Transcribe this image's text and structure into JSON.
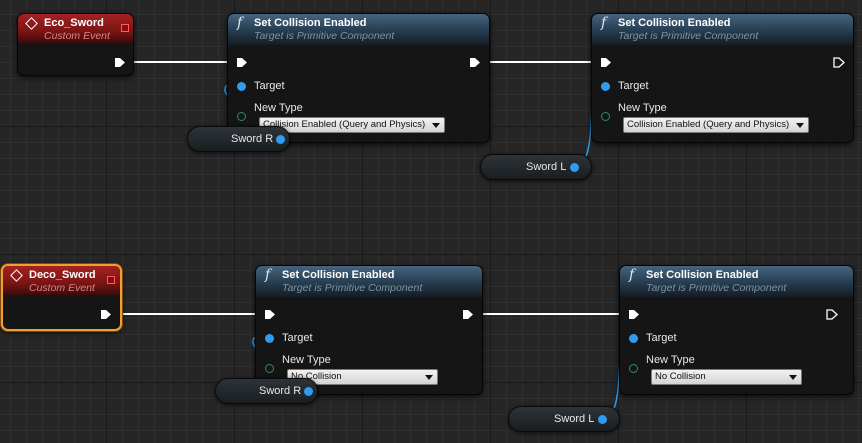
{
  "events": [
    {
      "title": "Eco_Sword",
      "subtitle": "Custom Event"
    },
    {
      "title": "Deco_Sword",
      "subtitle": "Custom Event"
    }
  ],
  "functions": [
    {
      "title": "Set Collision Enabled",
      "subtitle": "Target is Primitive Component",
      "target_label": "Target",
      "newtype_label": "New Type",
      "newtype_value": "Collision Enabled (Query and Physics)"
    },
    {
      "title": "Set Collision Enabled",
      "subtitle": "Target is Primitive Component",
      "target_label": "Target",
      "newtype_label": "New Type",
      "newtype_value": "Collision Enabled (Query and Physics)"
    },
    {
      "title": "Set Collision Enabled",
      "subtitle": "Target is Primitive Component",
      "target_label": "Target",
      "newtype_label": "New Type",
      "newtype_value": "No Collision"
    },
    {
      "title": "Set Collision Enabled",
      "subtitle": "Target is Primitive Component",
      "target_label": "Target",
      "newtype_label": "New Type",
      "newtype_value": "No Collision"
    }
  ],
  "variables": [
    {
      "label": "Sword R"
    },
    {
      "label": "Sword L"
    },
    {
      "label": "Sword R"
    },
    {
      "label": "Sword L"
    }
  ],
  "colors": {
    "exec_wire": "#ffffff",
    "object_wire": "#2f9cf0",
    "selection": "#f0a030",
    "event_header": "#a42222",
    "function_header": "#45647e"
  }
}
